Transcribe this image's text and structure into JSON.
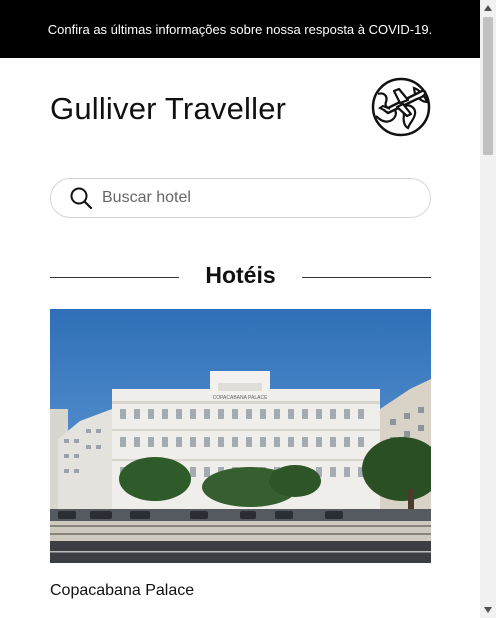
{
  "banner": {
    "text": "Confira as últimas informações sobre nossa resposta à COVID-19."
  },
  "header": {
    "title": "Gulliver Traveller",
    "logo_icon": "globe-plane-icon"
  },
  "search": {
    "placeholder": "Buscar hotel",
    "value": "",
    "icon": "search-icon"
  },
  "section": {
    "title": "Hotéis"
  },
  "hotels": [
    {
      "name": "Copacabana Palace",
      "photo_sign": "COPACABANA PALACE"
    }
  ],
  "colors": {
    "banner_bg": "#000000",
    "text": "#111111",
    "sky": "#3f7fc4",
    "building": "#ececea"
  }
}
